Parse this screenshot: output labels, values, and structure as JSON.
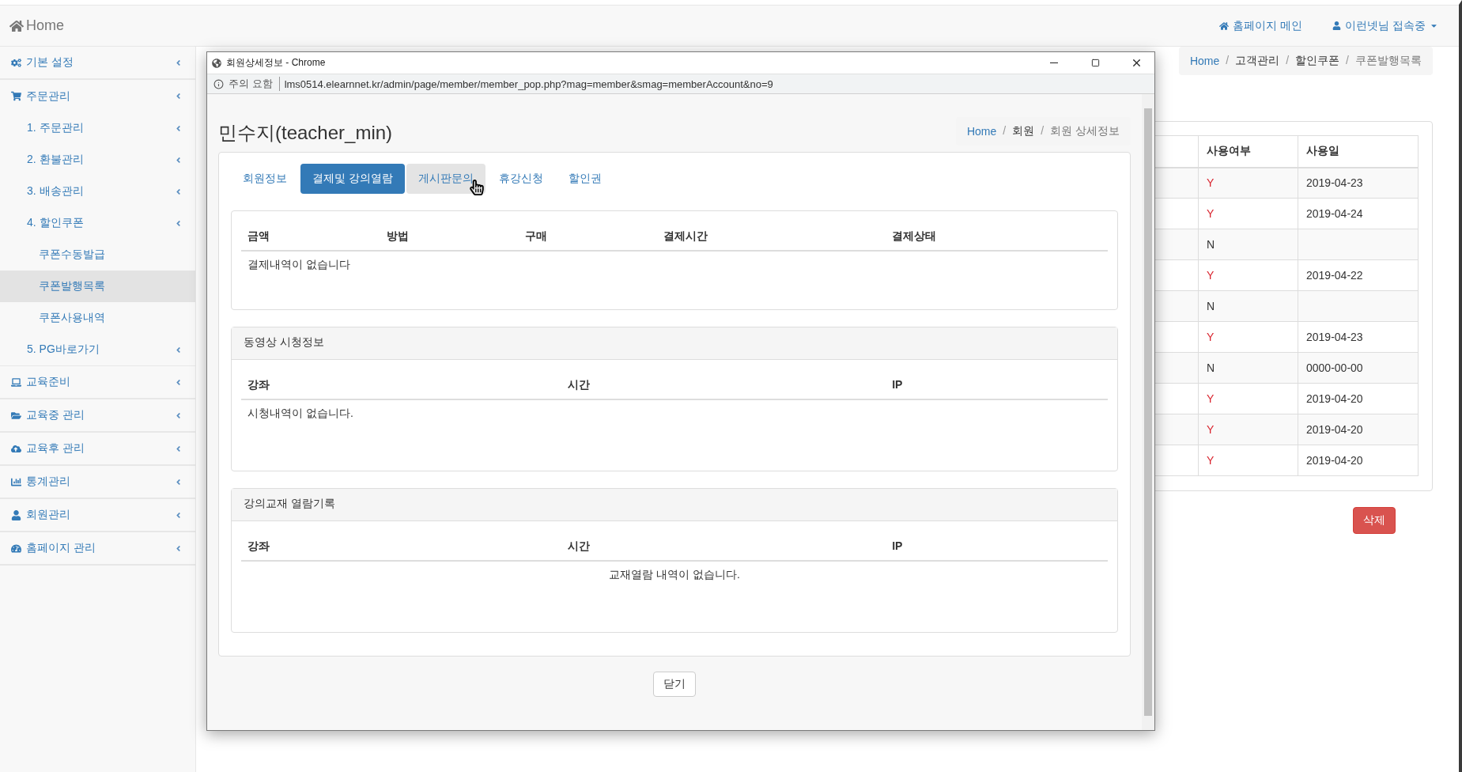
{
  "navbar": {
    "brand": "Home",
    "links": [
      {
        "label": "홈페이지 메인",
        "dropdown": false
      },
      {
        "label": "이런넷님 접속중",
        "dropdown": true
      }
    ]
  },
  "sidebar": {
    "items": [
      {
        "label": "기본 설정",
        "selected": false
      },
      {
        "label": "주문관리",
        "selected": false,
        "expanded": true,
        "children": [
          {
            "label": "1. 주문관리",
            "selected": false
          },
          {
            "label": "2. 환불관리",
            "selected": false
          },
          {
            "label": "3. 배송관리",
            "selected": false
          },
          {
            "label": "4. 할인쿠폰",
            "selected": false,
            "expanded": true,
            "children": [
              {
                "label": "쿠폰수동발급",
                "selected": false
              },
              {
                "label": "쿠폰발행목록",
                "selected": true
              },
              {
                "label": "쿠폰사용내역",
                "selected": false
              }
            ]
          },
          {
            "label": "5. PG바로가기",
            "selected": false
          }
        ]
      },
      {
        "label": "교육준비",
        "selected": false
      },
      {
        "label": "교육중 관리",
        "selected": false
      },
      {
        "label": "교육후 관리",
        "selected": false
      },
      {
        "label": "통계관리",
        "selected": false
      },
      {
        "label": "회원관리",
        "selected": false
      },
      {
        "label": "홈페이지 관리",
        "selected": false
      }
    ]
  },
  "breadcrumb": {
    "separator": "/",
    "items": [
      {
        "label": "Home",
        "kind": "link"
      },
      {
        "label": "고객관리",
        "kind": "text"
      },
      {
        "label": "할인쿠폰",
        "kind": "text"
      },
      {
        "label": "쿠폰발행목록",
        "kind": "active"
      }
    ]
  },
  "coupon_table": {
    "columns": [
      "사용여부",
      "사용일"
    ],
    "rows": [
      {
        "flag": "Y",
        "used": true,
        "date": "2019-04-23"
      },
      {
        "flag": "Y",
        "used": true,
        "date": "2019-04-24"
      },
      {
        "flag": "N",
        "used": false
      },
      {
        "flag": "Y",
        "used": true,
        "date": "2019-04-22"
      },
      {
        "flag": "N",
        "used": false
      },
      {
        "flag": "Y",
        "used": true,
        "date": "2019-04-23"
      },
      {
        "flag": "N",
        "used": false,
        "date": "0000-00-00"
      },
      {
        "flag": "Y",
        "used": true,
        "date": "2019-04-20"
      },
      {
        "flag": "Y",
        "used": true,
        "date": "2019-04-20"
      },
      {
        "flag": "Y",
        "used": true,
        "date": "2019-04-20"
      }
    ]
  },
  "delete_button": "삭제",
  "popup": {
    "window_title": "회원상세정보 - Chrome",
    "security_label": "주의 요함",
    "url": "lms0514.elearnnet.kr/admin/page/member/member_pop.php?mag=member&smag=memberAccount&no=9",
    "heading": "민수지(teacher_min)",
    "breadcrumb": {
      "separator": "/",
      "items": [
        {
          "label": "Home",
          "kind": "link"
        },
        {
          "label": "회원",
          "kind": "text"
        },
        {
          "label": "회원 상세정보",
          "kind": "active"
        }
      ]
    },
    "tabs": [
      {
        "label": "회원정보",
        "selected": false,
        "hovered": false
      },
      {
        "label": "결제및 강의열람",
        "selected": true,
        "hovered": false
      },
      {
        "label": "게시판문의",
        "selected": false,
        "hovered": true
      },
      {
        "label": "휴강신청",
        "selected": false,
        "hovered": false
      },
      {
        "label": "할인권",
        "selected": false,
        "hovered": false
      }
    ],
    "panels": [
      {
        "columns": [
          "금액",
          "방법",
          "구매",
          "결제시간",
          "결제상태"
        ],
        "empty_message": "결제내역이 없습니다",
        "message_centered": false
      },
      {
        "title": "동영상 시청정보",
        "columns": [
          "강좌",
          "시간",
          "IP"
        ],
        "empty_message": "시청내역이 없습니다.",
        "message_centered": false
      },
      {
        "title": "강의교재 열람기록",
        "columns": [
          "강좌",
          "시간",
          "IP"
        ],
        "empty_message": "교재열람 내역이 없습니다.",
        "message_centered": true
      }
    ],
    "close_button": "닫기"
  }
}
